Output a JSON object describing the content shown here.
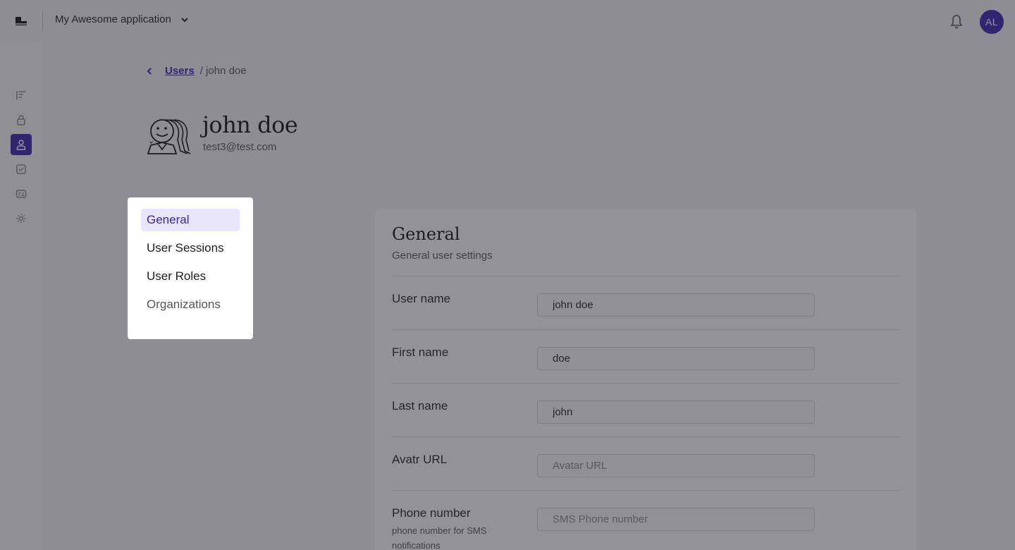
{
  "header": {
    "app_name": "My Awesome application",
    "avatar_initials": "AL"
  },
  "breadcrumb": {
    "parent": "Users",
    "current": "/ john doe"
  },
  "user": {
    "name": "john doe",
    "email": "test3@test.com"
  },
  "tabs": [
    {
      "label": "General",
      "active": true
    },
    {
      "label": "User Sessions",
      "active": false
    },
    {
      "label": "User Roles",
      "active": false
    },
    {
      "label": "Organizations",
      "active": false
    }
  ],
  "panel": {
    "title": "General",
    "subtitle": "General user settings",
    "fields": [
      {
        "label": "User name",
        "value": "john doe",
        "placeholder": ""
      },
      {
        "label": "First name",
        "value": "doe",
        "placeholder": ""
      },
      {
        "label": "Last name",
        "value": "john",
        "placeholder": ""
      },
      {
        "label": "Avatr URL",
        "value": "",
        "placeholder": "Avatar URL"
      },
      {
        "label": "Phone number",
        "help": "phone number for SMS notifications",
        "value": "",
        "placeholder": "SMS Phone number"
      }
    ]
  },
  "colors": {
    "accent": "#3b22b5",
    "active_tab_bg": "#e9e6fb"
  },
  "nav_icons": [
    "flows-icon",
    "lock-icon",
    "user-icon",
    "checkbox-icon",
    "subtitles-icon",
    "gear-icon"
  ]
}
